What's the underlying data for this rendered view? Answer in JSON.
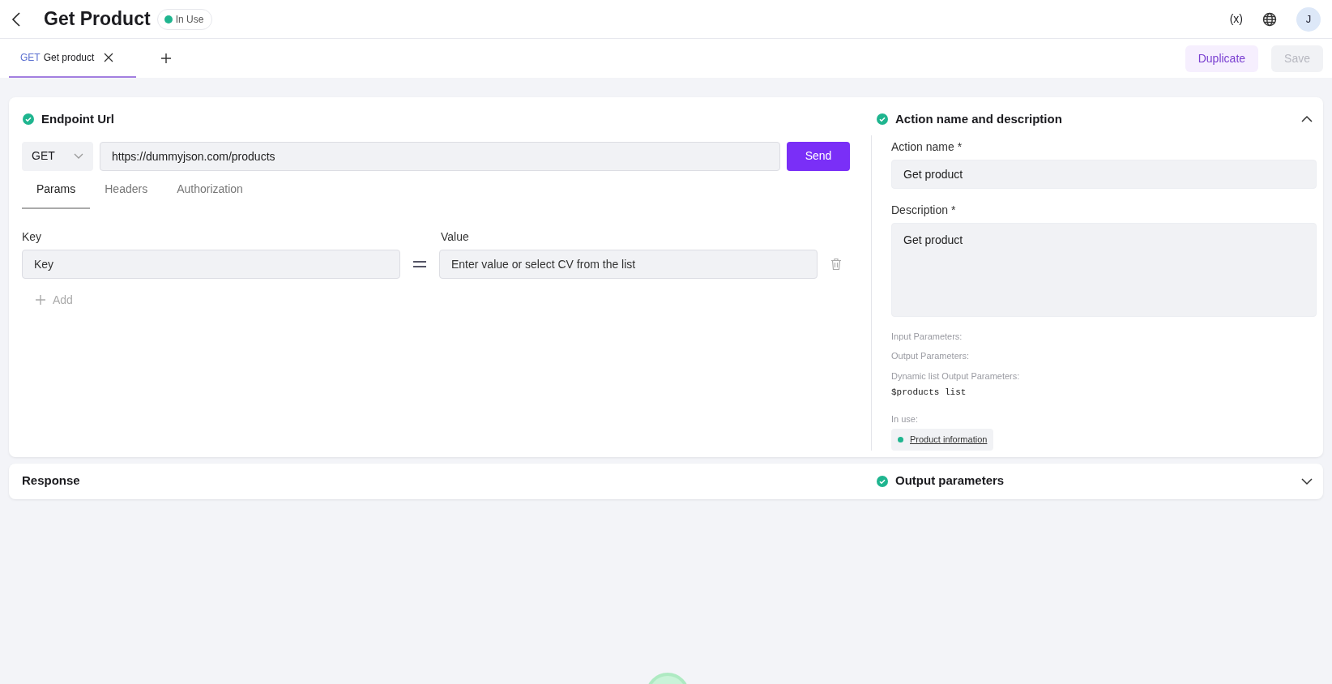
{
  "header": {
    "title": "Get Product",
    "status": {
      "label": "In Use",
      "color": "#1fb58f"
    },
    "variables": "(x)",
    "avatar": "J"
  },
  "tabs": [
    {
      "method": "GET",
      "label": "Get product",
      "selected": true
    }
  ],
  "toolbar": {
    "buttons": [
      {
        "label": "Duplicate",
        "kind": "secondary",
        "disabled": false
      },
      {
        "label": "Save",
        "kind": "primary",
        "disabled": true
      }
    ]
  },
  "endpoint": {
    "title": "Endpoint Url",
    "done": true,
    "method": "GET",
    "url": "https://dummyjson.com/products",
    "send": "Send",
    "subtabs": [
      {
        "label": "Params",
        "selected": true
      },
      {
        "label": "Headers",
        "selected": false
      },
      {
        "label": "Authorization",
        "selected": false
      }
    ],
    "key_label": "Key",
    "value_label": "Value",
    "rows": [
      {
        "key_placeholder": "Key",
        "value_placeholder": "Enter value or select CV from the list"
      }
    ],
    "add": "Add"
  },
  "action": {
    "title": "Action name and description",
    "done": true,
    "expanded": true,
    "name_label": "Action name *",
    "name_value": "Get product",
    "description_label": "Description *",
    "description_value": "Get product",
    "input_label": "Input Parameters:",
    "output_label": "Output Parameters:",
    "dynamic_label": "Dynamic list Output Parameters:",
    "dynamic_value": "$products list",
    "in_use_label": "In use:",
    "in_use": [
      {
        "label": "Product information",
        "color": "#1fb58f"
      }
    ]
  },
  "response": {
    "title": "Response"
  },
  "output": {
    "title": "Output parameters",
    "done": true,
    "expanded": false
  }
}
